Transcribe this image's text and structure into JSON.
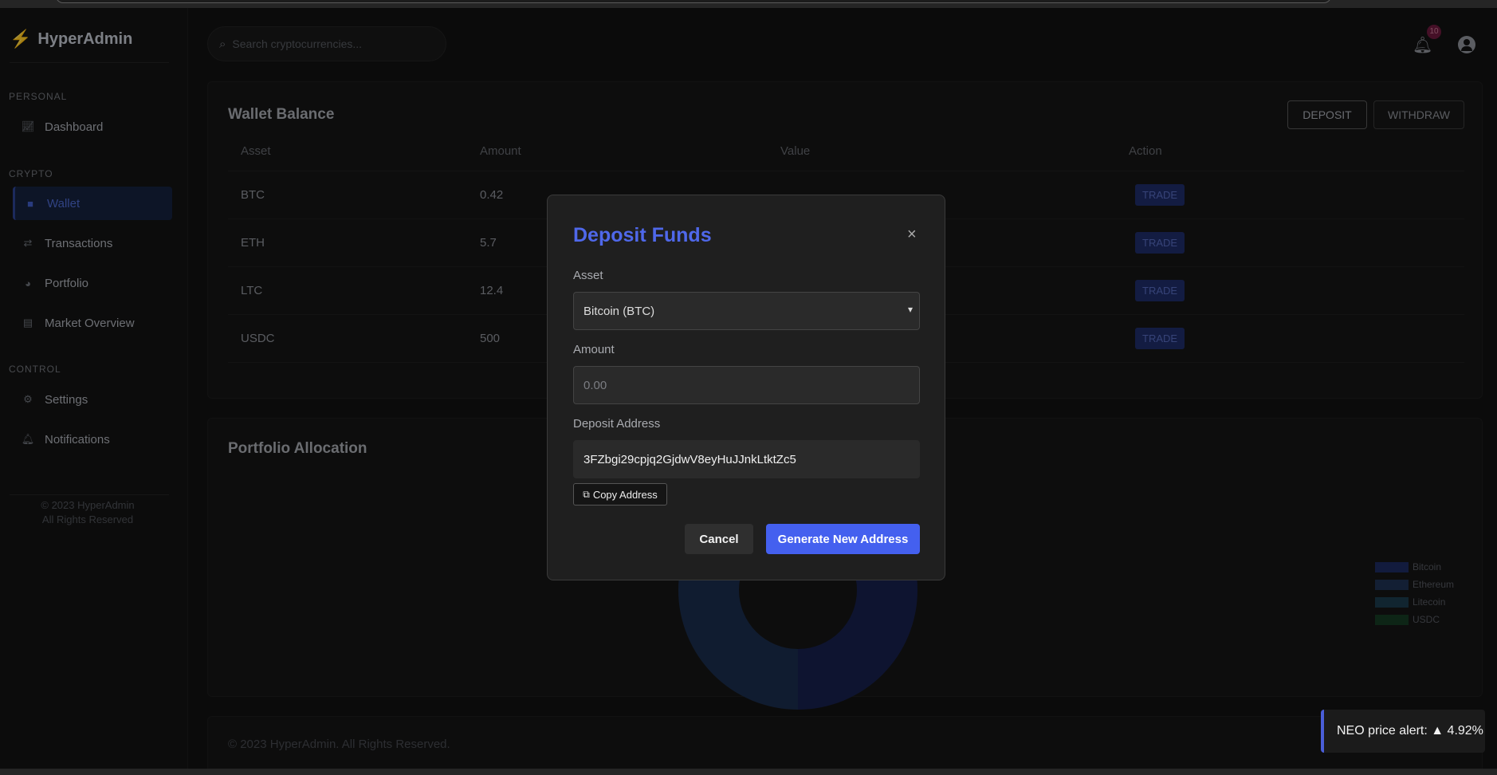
{
  "brand": {
    "icon": "bolt-icon",
    "name": "HyperAdmin"
  },
  "sidebar": {
    "sections": [
      {
        "title": "PERSONAL"
      },
      {
        "title": "CRYPTO"
      },
      {
        "title": "CONTROL"
      }
    ],
    "items": [
      {
        "label": "Dashboard",
        "icon": "chart-line-icon"
      },
      {
        "label": "Wallet",
        "icon": "wallet-icon",
        "active": true
      },
      {
        "label": "Transactions",
        "icon": "exchange-icon"
      },
      {
        "label": "Portfolio",
        "icon": "pie-chart-icon"
      },
      {
        "label": "Market Overview",
        "icon": "bar-chart-icon"
      },
      {
        "label": "Settings",
        "icon": "gear-icon"
      },
      {
        "label": "Notifications",
        "icon": "bell-icon"
      }
    ],
    "footer_line1": "© 2023 HyperAdmin",
    "footer_line2": "All Rights Reserved"
  },
  "header": {
    "search_placeholder": "Search cryptocurrencies...",
    "notification_count": "10"
  },
  "wallet": {
    "title": "Wallet Balance",
    "deposit_label": "DEPOSIT",
    "withdraw_label": "WITHDRAW",
    "columns": [
      "Asset",
      "Amount",
      "Value",
      "Action"
    ],
    "rows": [
      {
        "asset": "BTC",
        "amount": "0.42",
        "action": "TRADE"
      },
      {
        "asset": "ETH",
        "amount": "5.7",
        "action": "TRADE"
      },
      {
        "asset": "LTC",
        "amount": "12.4",
        "action": "TRADE"
      },
      {
        "asset": "USDC",
        "amount": "500",
        "action": "TRADE"
      }
    ]
  },
  "portfolio": {
    "title": "Portfolio Allocation",
    "legend": [
      {
        "label": "Bitcoin",
        "color": "#1c2a5e"
      },
      {
        "label": "Ethereum",
        "color": "#1e3150"
      },
      {
        "label": "Litecoin",
        "color": "#1b3a4a"
      },
      {
        "label": "USDC",
        "color": "#143a22"
      }
    ]
  },
  "footer": {
    "text": "© 2023 HyperAdmin. All Rights Reserved."
  },
  "modal": {
    "title": "Deposit Funds",
    "close_label": "×",
    "asset_label": "Asset",
    "asset_value": "Bitcoin (BTC)",
    "amount_label": "Amount",
    "amount_placeholder": "0.00",
    "address_label": "Deposit Address",
    "address_value": "3FZbgi29cpjq2GjdwV8eyHuJJnkLtktZc5",
    "copy_label": "Copy Address",
    "cancel_label": "Cancel",
    "generate_label": "Generate New Address"
  },
  "toast": {
    "text": "NEO price alert: ▲ 4.92%"
  }
}
